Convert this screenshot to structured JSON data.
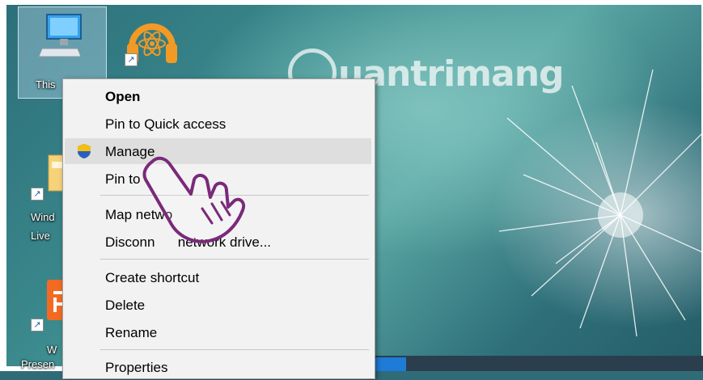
{
  "desktop": {
    "icons": [
      {
        "name": "this-pc",
        "label": "This",
        "icon": "computer-icon"
      },
      {
        "name": "music-app",
        "label": "",
        "icon": "headphones-atom-icon"
      },
      {
        "name": "windows-live",
        "label_line1": "Wind",
        "label_line2": "Live",
        "icon": "folder-icon"
      },
      {
        "name": "presentation-app",
        "label_line1": "W",
        "label_line2": "Presen",
        "icon": "presentation-icon"
      }
    ]
  },
  "watermark": {
    "text": "uantrimang"
  },
  "context_menu": {
    "items": [
      {
        "label": "Open",
        "bold": true
      },
      {
        "label": "Pin to Quick access"
      },
      {
        "label": "Manage",
        "icon": "uac-shield-icon",
        "highlighted": true
      },
      {
        "label": "Pin to"
      },
      {
        "label": "Map netwo"
      },
      {
        "label": "Disconn      network drive..."
      },
      {
        "label": "Create shortcut"
      },
      {
        "label": "Delete"
      },
      {
        "label": "Rename"
      },
      {
        "label": "Properties"
      }
    ]
  },
  "colors": {
    "menu_bg": "#f2f2f2",
    "menu_highlight": "#dedede",
    "pointer_hand": "#7a2a7a",
    "taskbar": "#2b3e4e",
    "taskbar_accent": "#1f7bd8"
  }
}
